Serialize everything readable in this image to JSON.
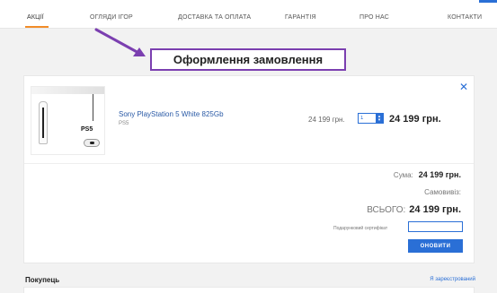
{
  "nav": {
    "items": [
      "Акції",
      "Огляди ігор",
      "Доставка та оплата",
      "Гарантія",
      "Про нас",
      "Контакти"
    ],
    "active_index": 0
  },
  "annotation": {
    "title": "Оформлення замовлення",
    "highlight_color": "#7b3fb0"
  },
  "cart": {
    "product": {
      "name": "Sony PlayStation 5 White 825Gb",
      "sku": "PS5",
      "image_logo": "PS5",
      "unit_price": "24 199 грн.",
      "quantity": "1",
      "line_total": "24 199 грн."
    },
    "summary": {
      "sum_label": "Сума:",
      "sum_value": "24 199 грн.",
      "pickup_label": "Самовивіз:",
      "total_label": "ВСЬОГО:",
      "total_value": "24 199 грн."
    },
    "gift_label": "Подарунковий сертифікат",
    "update_button": "ОНОВИТИ"
  },
  "buyer": {
    "label": "Покупець",
    "registered_link": "Я зареєстрований"
  },
  "colors": {
    "accent": "#2a6fd6",
    "nav_active_underline": "#f28c28"
  },
  "icons": {
    "close": "close-icon",
    "spin": "spinner-icon",
    "arrow": "arrow-annotation-icon"
  }
}
